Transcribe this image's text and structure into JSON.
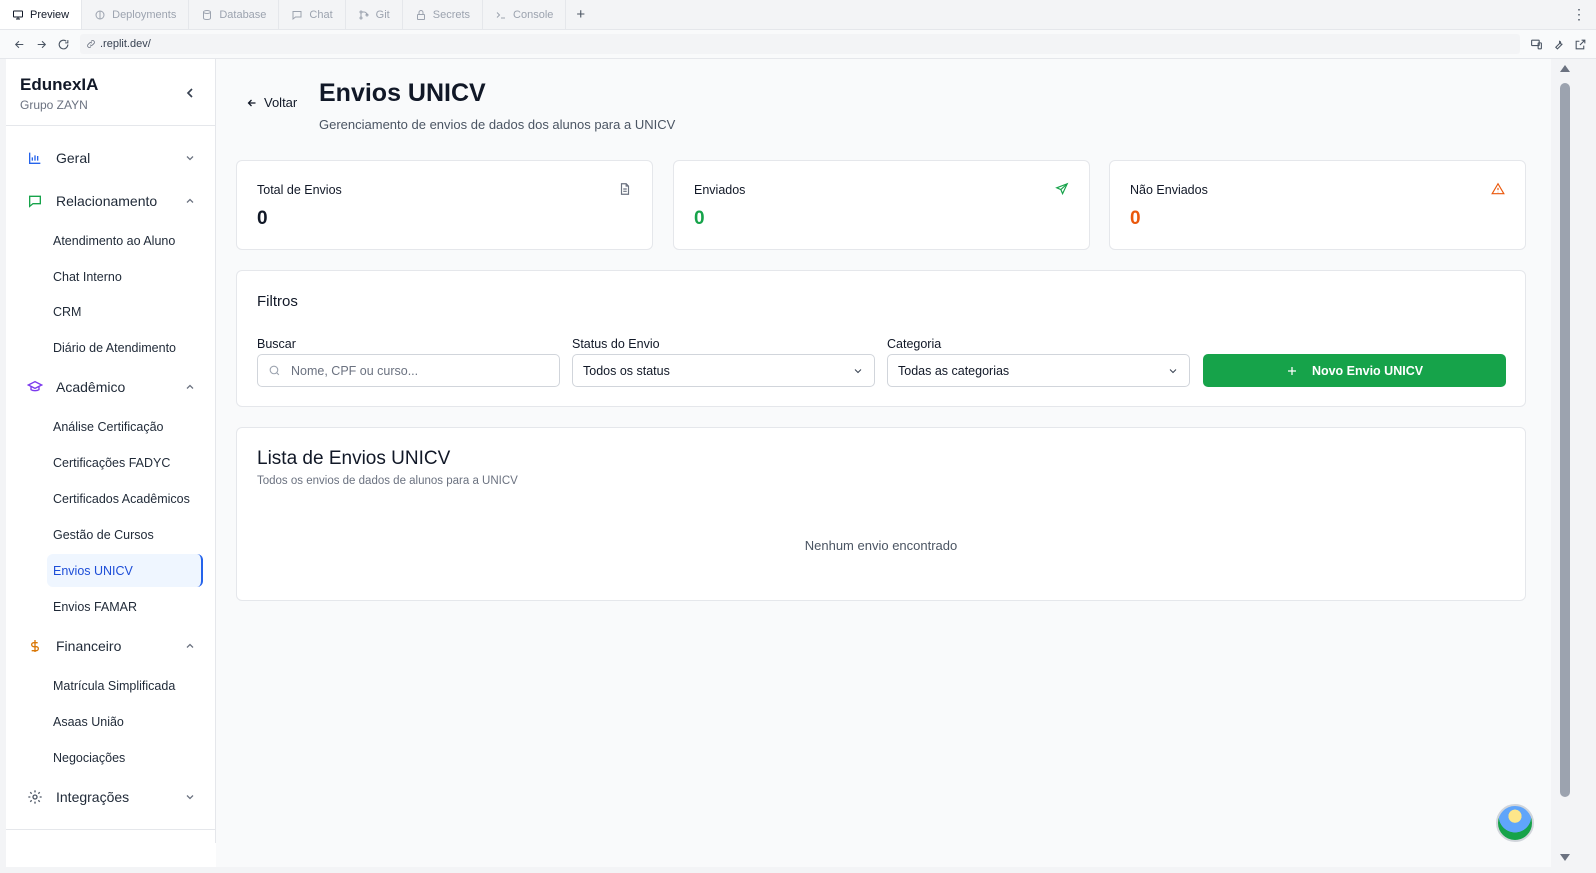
{
  "browser": {
    "tabs": [
      {
        "label": "Preview",
        "icon": "monitor-icon",
        "active": true
      },
      {
        "label": "Deployments",
        "icon": "deploy-icon",
        "active": false
      },
      {
        "label": "Database",
        "icon": "database-icon",
        "active": false
      },
      {
        "label": "Chat",
        "icon": "chat-icon",
        "active": false
      },
      {
        "label": "Git",
        "icon": "git-icon",
        "active": false
      },
      {
        "label": "Secrets",
        "icon": "lock-icon",
        "active": false
      },
      {
        "label": "Console",
        "icon": "terminal-icon",
        "active": false
      }
    ],
    "new_tab": "+",
    "url": ".replit.dev/"
  },
  "sidebar": {
    "brand_title": "EdunexIA",
    "brand_sub": "Grupo ZAYN",
    "sections": [
      {
        "label": "Geral",
        "icon": "bar-chart-icon",
        "color": "#2563eb",
        "expanded": false,
        "items": []
      },
      {
        "label": "Relacionamento",
        "icon": "message-square-icon",
        "color": "#16a34a",
        "expanded": true,
        "items": [
          "Atendimento ao Aluno",
          "Chat Interno",
          "CRM",
          "Diário de Atendimento"
        ]
      },
      {
        "label": "Acadêmico",
        "icon": "graduation-cap-icon",
        "color": "#7c3aed",
        "expanded": true,
        "items": [
          "Análise Certificação",
          "Certificações FADYC",
          "Certificados Acadêmicos",
          "Gestão de Cursos",
          "Envios UNICV",
          "Envios FAMAR"
        ]
      },
      {
        "label": "Financeiro",
        "icon": "dollar-icon",
        "color": "#d97706",
        "expanded": true,
        "items": [
          "Matrícula Simplificada",
          "Asaas União",
          "Negociações"
        ]
      },
      {
        "label": "Integrações",
        "icon": "gear-icon",
        "color": "#4b5563",
        "expanded": false,
        "items": []
      }
    ],
    "active_item": "Envios UNICV"
  },
  "header": {
    "back_label": "Voltar",
    "title": "Envios UNICV",
    "subtitle": "Gerenciamento de envios de dados dos alunos para a UNICV"
  },
  "stats": [
    {
      "label": "Total de Envios",
      "value": "0",
      "icon": "file-icon",
      "color": "#111827"
    },
    {
      "label": "Enviados",
      "value": "0",
      "icon": "send-icon",
      "color": "#16a34a"
    },
    {
      "label": "Não Enviados",
      "value": "0",
      "icon": "alert-triangle-icon",
      "color": "#ea580c"
    }
  ],
  "filters": {
    "title": "Filtros",
    "search_label": "Buscar",
    "search_placeholder": "Nome, CPF ou curso...",
    "status_label": "Status do Envio",
    "status_value": "Todos os status",
    "category_label": "Categoria",
    "category_value": "Todas as categorias",
    "new_button": "Novo Envio UNICV"
  },
  "list": {
    "title": "Lista de Envios UNICV",
    "subtitle": "Todos os envios de dados de alunos para a UNICV",
    "empty_message": "Nenhum envio encontrado"
  }
}
